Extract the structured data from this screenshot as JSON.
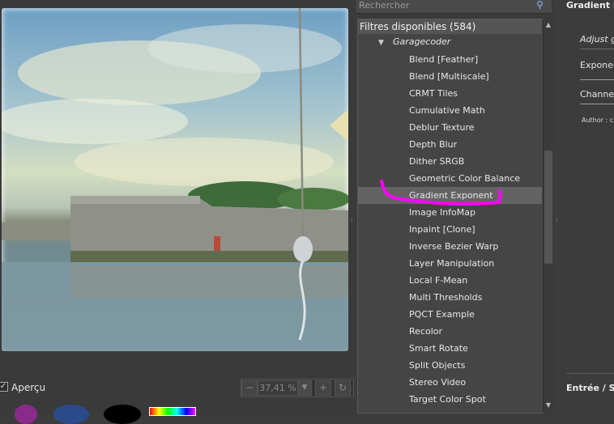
{
  "search": {
    "placeholder": "Rechercher"
  },
  "filters": {
    "header": "Filtres disponibles (584)",
    "group": "Garagecoder",
    "items": [
      "Blend [Feather]",
      "Blend [Multiscale]",
      "CRMT Tiles",
      "Cumulative Math",
      "Deblur Texture",
      "Depth Blur",
      "Dither SRGB",
      "Geometric Color Balance",
      "Gradient Exponent",
      "Image InfoMap",
      "Inpaint [Clone]",
      "Inverse Bezier Warp",
      "Layer Manipulation",
      "Local F-Mean",
      "Multi Thresholds",
      "PQCT Example",
      "Recolor",
      "Smart Rotate",
      "Split Objects",
      "Stereo Video",
      "Target Color Spot"
    ],
    "selected": "Gradient Exponent"
  },
  "preview": {
    "apercu_label": "Aperçu",
    "apercu_checked": "✓",
    "zoom": "37,41 %"
  },
  "params": {
    "title": "Gradient E",
    "adjust": "Adjust g",
    "exponent": "Exponen",
    "channels": "Channels",
    "author": "Author : c",
    "entree": "Entrée / Sc"
  },
  "colors": {
    "highlight": "#ff00ff",
    "selected_row": "#636363"
  }
}
